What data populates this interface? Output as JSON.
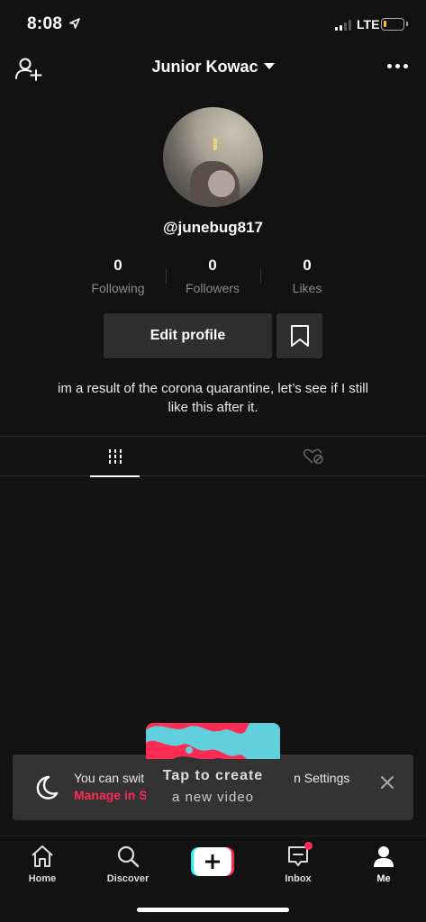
{
  "status_bar": {
    "time": "8:08",
    "network": "LTE",
    "battery_level": 0.15
  },
  "header": {
    "account_name": "Junior Kowac"
  },
  "profile": {
    "handle": "@junebug817",
    "stats": [
      {
        "value": "0",
        "label": "Following"
      },
      {
        "value": "0",
        "label": "Followers"
      },
      {
        "value": "0",
        "label": "Likes"
      }
    ],
    "edit_label": "Edit profile",
    "bio_line1": "im a result of the corona quarantine, let’s see if I still",
    "bio_line2": "like this after it."
  },
  "tabs": {
    "active": "videos"
  },
  "toast": {
    "message": "You can swit",
    "message_end": "n Settings",
    "link": "Manage in S"
  },
  "tooltip": {
    "line1": "Tap to create",
    "line2": "a new video"
  },
  "bottom_nav": [
    {
      "label": "Home"
    },
    {
      "label": "Discover"
    },
    {
      "label": "Inbox"
    },
    {
      "label": "Me"
    }
  ],
  "colors": {
    "accent": "#fe2c55",
    "cyan": "#25f4ee",
    "background": "#121212"
  }
}
